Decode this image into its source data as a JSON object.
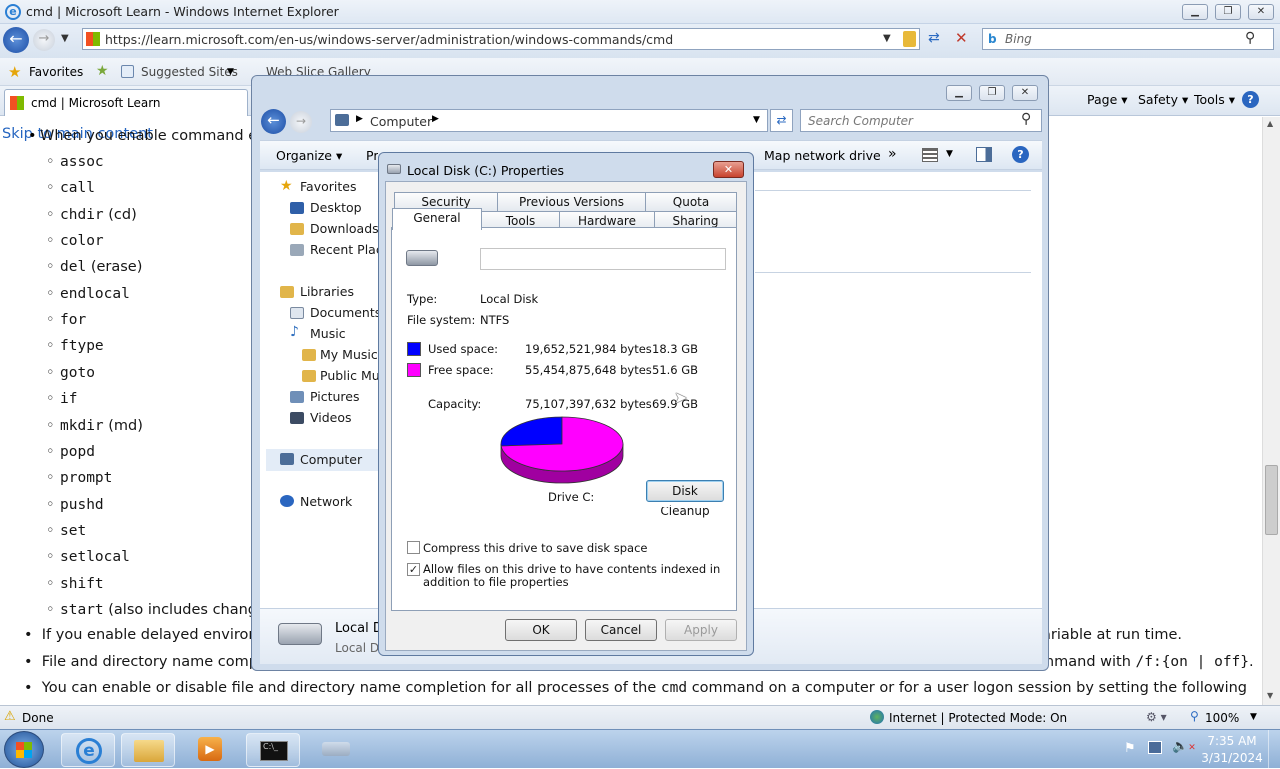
{
  "ie": {
    "title": "cmd | Microsoft Learn - Windows Internet Explorer",
    "url": "https://learn.microsoft.com/en-us/windows-server/administration/windows-commands/cmd",
    "search_placeholder": "Bing",
    "favorites": "Favorites",
    "suggested_sites": "Suggested Sites",
    "web_slice": "Web Slice Gallery",
    "tab_title": "cmd | Microsoft Learn",
    "menu": {
      "page": "Page",
      "safety": "Safety",
      "tools": "Tools"
    }
  },
  "page": {
    "skip_link": "Skip to main content",
    "intro": "When you enable command ex",
    "commands": [
      "assoc",
      "call",
      "chdir",
      "color",
      "del",
      "endlocal",
      "for",
      "ftype",
      "goto",
      "if",
      "mkdir",
      "popd",
      "prompt",
      "pushd",
      "set",
      "setlocal",
      "shift",
      "start"
    ],
    "command_suffix": {
      "chdir": "(cd)",
      "del": "(erase)",
      "mkdir": "(md)",
      "start": "(also includes chang"
    },
    "bullet1_left": "If you enable delayed environ",
    "bullet1_right": "ariable at run time.",
    "bullet2_left": "File and directory name compl",
    "bullet2_right_pre": "mmand with",
    "bullet2_code": "/f:{on | off}",
    "bullet2_end": ".",
    "bullet3_pre": "You can enable or disable file and directory name completion for all processes of the",
    "bullet3_code": "cmd",
    "bullet3_post": "command on a computer or for a user logon session by setting the following"
  },
  "status": {
    "text": "Done",
    "zone": "Internet | Protected Mode: On",
    "zoom": "100%"
  },
  "taskbar": {
    "time": "7:35 AM",
    "date": "3/31/2024"
  },
  "explorer": {
    "crumb": "Computer",
    "search_placeholder": "Search Computer",
    "toolbar": {
      "organize": "Organize",
      "properties": "Properties",
      "map": "Map network drive",
      "more": "»"
    },
    "nav": {
      "favorites": "Favorites",
      "desktop": "Desktop",
      "downloads": "Downloads",
      "recent": "Recent Place",
      "libraries": "Libraries",
      "documents": "Documents",
      "music": "Music",
      "my_music": "My Music",
      "public_music": "Public Mus",
      "pictures": "Pictures",
      "videos": "Videos",
      "computer": "Computer",
      "network": "Network"
    },
    "details_name": "Local D",
    "details_sub": "Local Di"
  },
  "dialog": {
    "title": "Local Disk (C:) Properties",
    "tabs_top": [
      "Security",
      "Previous Versions",
      "Quota"
    ],
    "tabs_bottom": [
      "General",
      "Tools",
      "Hardware",
      "Sharing"
    ],
    "label_value": "",
    "type_label": "Type:",
    "type_value": "Local Disk",
    "fs_label": "File system:",
    "fs_value": "NTFS",
    "used_label": "Used space:",
    "used_bytes": "19,652,521,984 bytes",
    "used_gb": "18.3 GB",
    "free_label": "Free space:",
    "free_bytes": "55,454,875,648 bytes",
    "free_gb": "51.6 GB",
    "cap_label": "Capacity:",
    "cap_bytes": "75,107,397,632 bytes",
    "cap_gb": "69.9 GB",
    "drive_label": "Drive C:",
    "cleanup": "Disk Cleanup",
    "compress": "Compress this drive to save disk space",
    "compress_checked": false,
    "index": "Allow files on this drive to have contents indexed in addition to file properties",
    "index_checked": true,
    "ok": "OK",
    "cancel": "Cancel",
    "apply": "Apply",
    "colors": {
      "used": "#0000ff",
      "free": "#ff00ff"
    }
  },
  "chart_data": {
    "type": "pie",
    "categories": [
      "Used space",
      "Free space"
    ],
    "values": [
      18.3,
      51.6
    ],
    "title": "Drive C:"
  }
}
